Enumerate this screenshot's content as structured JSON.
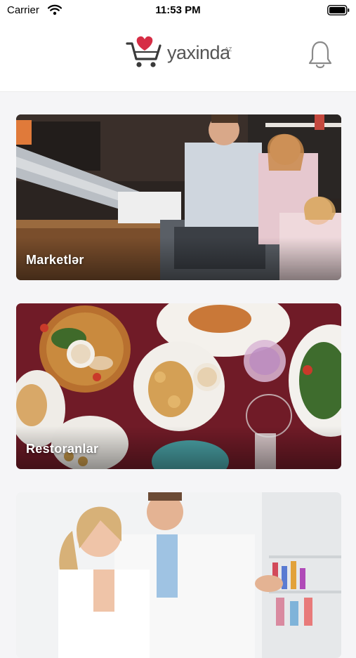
{
  "status_bar": {
    "carrier": "Carrier",
    "time": "11:53 PM"
  },
  "header": {
    "logo_text": "yaxinda",
    "logo_suffix": "AZ",
    "brand_color": "#d62d45",
    "notification_icon": "bell-icon"
  },
  "categories": [
    {
      "label": "Marketlər",
      "image": "supermarket-family-photo"
    },
    {
      "label": "Restoranlar",
      "image": "restaurant-table-food-photo"
    },
    {
      "label": "",
      "image": "pharmacy-pharmacists-photo"
    }
  ]
}
